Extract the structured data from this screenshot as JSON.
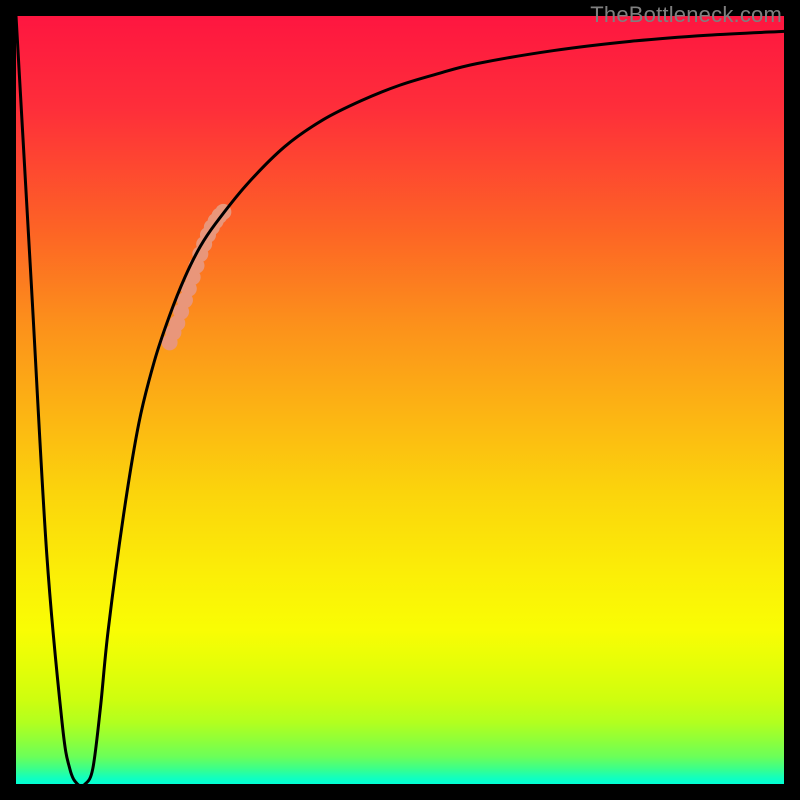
{
  "watermark": "TheBottleneck.com",
  "chart_data": {
    "type": "line",
    "title": "",
    "xlabel": "",
    "ylabel": "",
    "xlim": [
      0,
      100
    ],
    "ylim": [
      0,
      100
    ],
    "grid": false,
    "legend": false,
    "series": [
      {
        "name": "bottleneck-curve",
        "color": "#000000",
        "x": [
          0,
          2,
          4,
          6,
          7,
          8,
          9,
          10,
          11,
          12,
          14,
          16,
          18,
          20,
          22,
          24,
          26,
          30,
          35,
          40,
          45,
          50,
          55,
          60,
          70,
          80,
          90,
          100
        ],
        "y": [
          100,
          65,
          30,
          8,
          2,
          0,
          0,
          2,
          10,
          20,
          35,
          47,
          55,
          61,
          66,
          70,
          73,
          78,
          83,
          86.5,
          89,
          91,
          92.5,
          93.8,
          95.5,
          96.7,
          97.5,
          98
        ]
      }
    ],
    "highlight": {
      "name": "highlight-segment",
      "color": "#e9967a",
      "radius_px": 8,
      "x": [
        20,
        20.5,
        21,
        21.5,
        22,
        22.5,
        23,
        23.5,
        24,
        24.5,
        25,
        25.5,
        26,
        26.5,
        27
      ],
      "y": [
        57.5,
        58.8,
        60,
        61.5,
        63,
        64.5,
        66,
        67.5,
        69,
        70.3,
        71.5,
        72.5,
        73.3,
        74,
        74.5
      ]
    }
  }
}
